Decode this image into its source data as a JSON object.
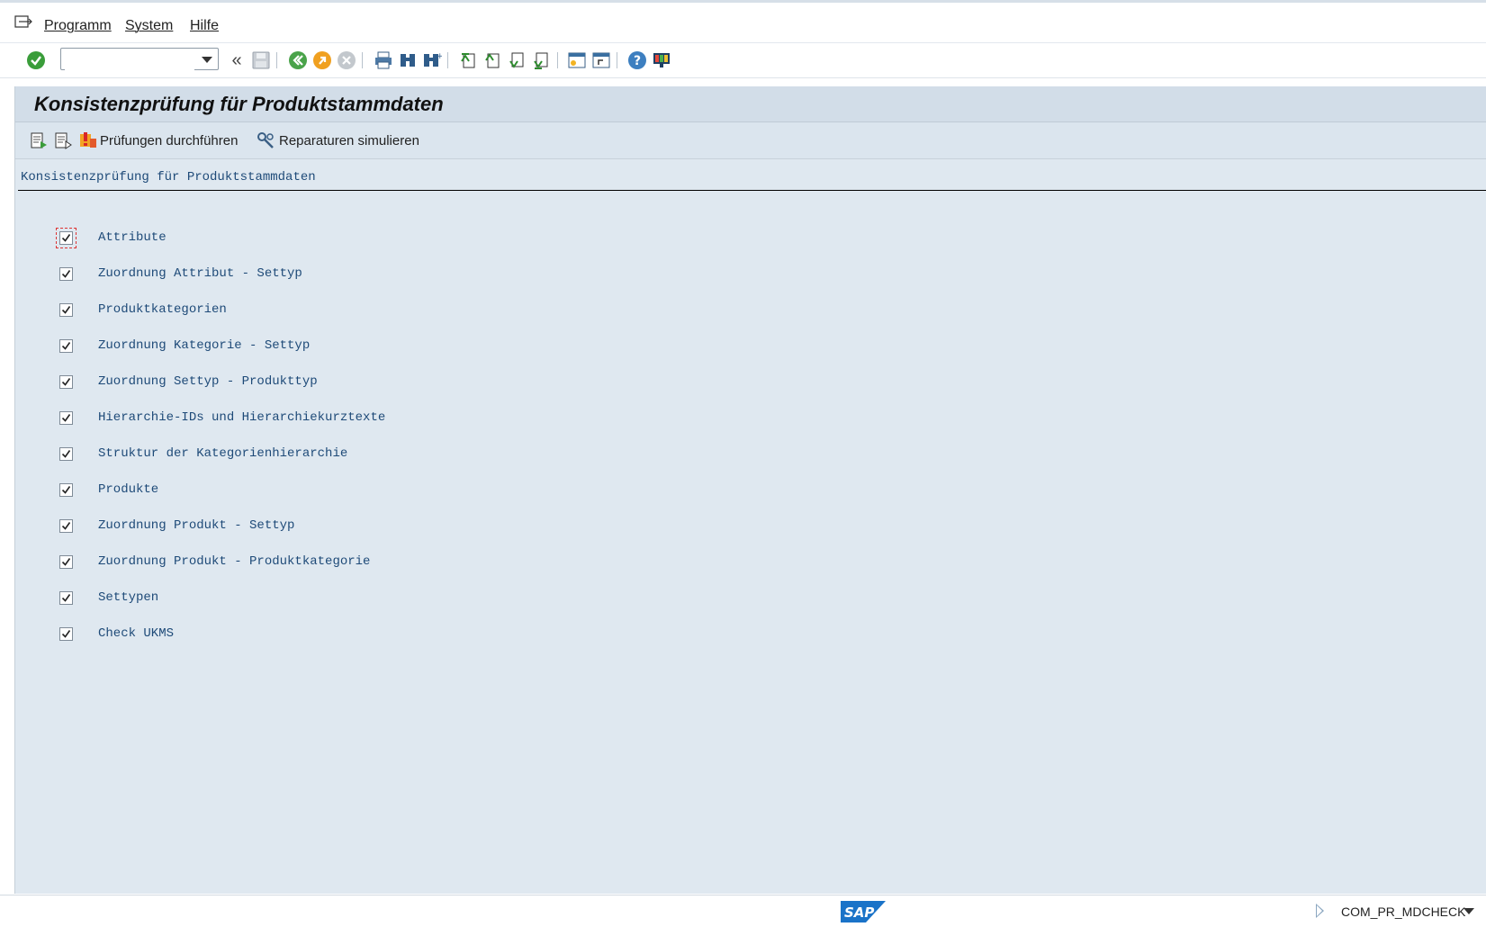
{
  "menu": {
    "items": [
      {
        "label": "Programm"
      },
      {
        "label": "System"
      },
      {
        "label": "Hilfe"
      }
    ]
  },
  "toolbar": {
    "command_value": "",
    "icons": [
      "enter-icon",
      "save-icon",
      "back-icon",
      "exit-icon",
      "cancel-icon",
      "print-icon",
      "find-icon",
      "find-next-icon",
      "first-page-icon",
      "previous-page-icon",
      "next-page-icon",
      "last-page-icon",
      "create-session-icon",
      "shortcut-icon",
      "help-icon",
      "customize-layout-icon"
    ]
  },
  "page": {
    "title": "Konsistenzprüfung für Produktstammdaten"
  },
  "app_toolbar": {
    "execute_label": "Prüfungen durchführen",
    "simulate_label": "Reparaturen simulieren"
  },
  "section": {
    "heading": "Konsistenzprüfung für Produktstammdaten",
    "checks": [
      {
        "label": "Attribute",
        "checked": true
      },
      {
        "label": "Zuordnung Attribut - Settyp",
        "checked": true
      },
      {
        "label": "Produktkategorien",
        "checked": true
      },
      {
        "label": "Zuordnung Kategorie - Settyp",
        "checked": true
      },
      {
        "label": "Zuordnung Settyp - Produkttyp",
        "checked": true
      },
      {
        "label": "Hierarchie-IDs und Hierarchiekurztexte",
        "checked": true
      },
      {
        "label": "Struktur der Kategorienhierarchie",
        "checked": true
      },
      {
        "label": "Produkte",
        "checked": true
      },
      {
        "label": "Zuordnung Produkt - Settyp",
        "checked": true
      },
      {
        "label": "Zuordnung Produkt - Produktkategorie",
        "checked": true
      },
      {
        "label": "Settypen",
        "checked": true
      },
      {
        "label": "Check UKMS",
        "checked": true
      }
    ]
  },
  "status": {
    "logo_text": "SAP",
    "transaction": "COM_PR_MDCHECK"
  }
}
